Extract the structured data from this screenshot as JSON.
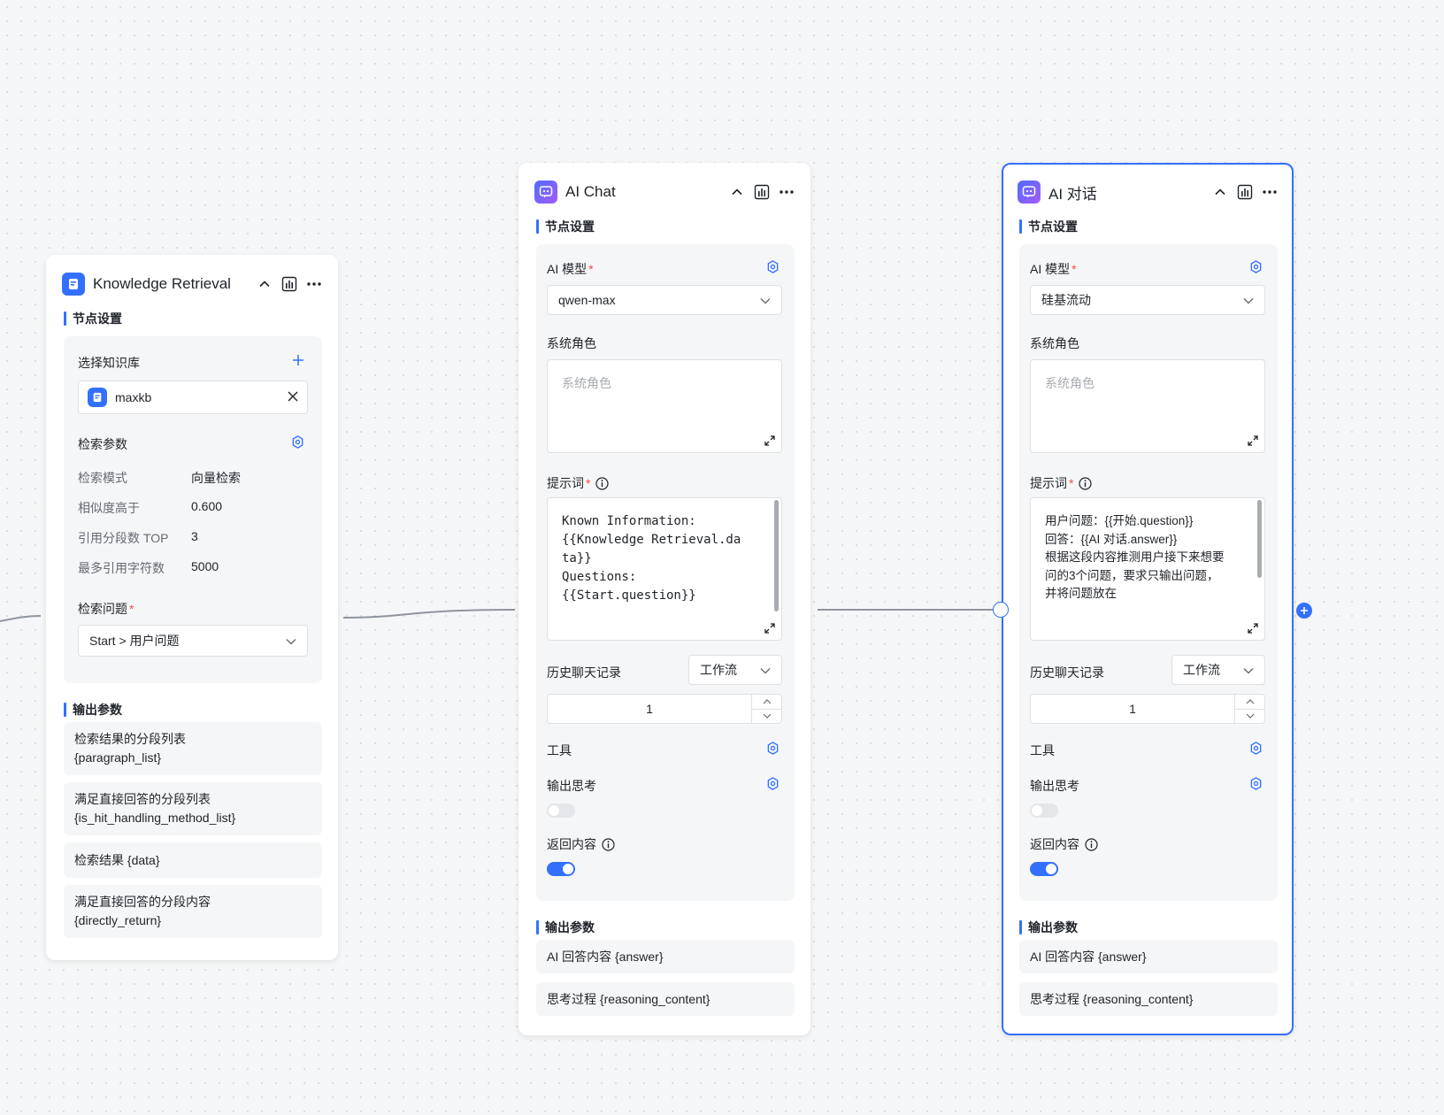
{
  "common": {
    "node_settings": "节点设置",
    "output_params": "输出参数"
  },
  "kr": {
    "title": "Knowledge Retrieval",
    "select_kb_label": "选择知识库",
    "kb_name": "maxkb",
    "search_params_label": "检索参数",
    "params": [
      {
        "k": "检索模式",
        "v": "向量检索"
      },
      {
        "k": "相似度高于",
        "v": "0.600"
      },
      {
        "k": "引用分段数 TOP",
        "v": "3"
      },
      {
        "k": "最多引用字符数",
        "v": "5000"
      }
    ],
    "question_label": "检索问题",
    "question_value": "Start > 用户问题",
    "outputs": [
      {
        "line1": "检索结果的分段列表",
        "line2": "{paragraph_list}"
      },
      {
        "line1": "满足直接回答的分段列表",
        "line2": "{is_hit_handling_method_list}"
      },
      {
        "line1": "检索结果 {data}",
        "line2": ""
      },
      {
        "line1": "满足直接回答的分段内容",
        "line2": "{directly_return}"
      }
    ]
  },
  "ai1": {
    "title": "AI Chat",
    "model_label": "AI 模型",
    "model_value": "qwen-max",
    "system_role_label": "系统角色",
    "system_role_placeholder": "系统角色",
    "prompt_label": "提示词",
    "prompt_text": "Known Information:\n{{Knowledge Retrieval.da\nta}}\nQuestions:\n{{Start.question}}",
    "history_label": "历史聊天记录",
    "history_mode": "工作流",
    "history_count": "1",
    "tools_label": "工具",
    "reasoning_label": "输出思考",
    "return_label": "返回内容",
    "reasoning_on": false,
    "return_on": true,
    "outputs": [
      "AI 回答内容 {answer}",
      "思考过程 {reasoning_content}"
    ]
  },
  "ai2": {
    "title": "AI 对话",
    "model_label": "AI 模型",
    "model_value": "硅基流动",
    "system_role_label": "系统角色",
    "system_role_placeholder": "系统角色",
    "prompt_label": "提示词",
    "prompt_text": "用户问题：{{开始.question}}\n回答：{{AI 对话.answer}}\n根据这段内容推测用户接下来想要\n问的3个问题，要求只输出问题，\n并将问题放在",
    "history_label": "历史聊天记录",
    "history_mode": "工作流",
    "history_count": "1",
    "tools_label": "工具",
    "reasoning_label": "输出思考",
    "return_label": "返回内容",
    "reasoning_on": false,
    "return_on": true,
    "outputs": [
      "AI 回答内容 {answer}",
      "思考过程 {reasoning_content}"
    ]
  },
  "colors": {
    "accent": "#3370ff",
    "required": "#f54a45",
    "canvas": "#f5f6f7"
  }
}
